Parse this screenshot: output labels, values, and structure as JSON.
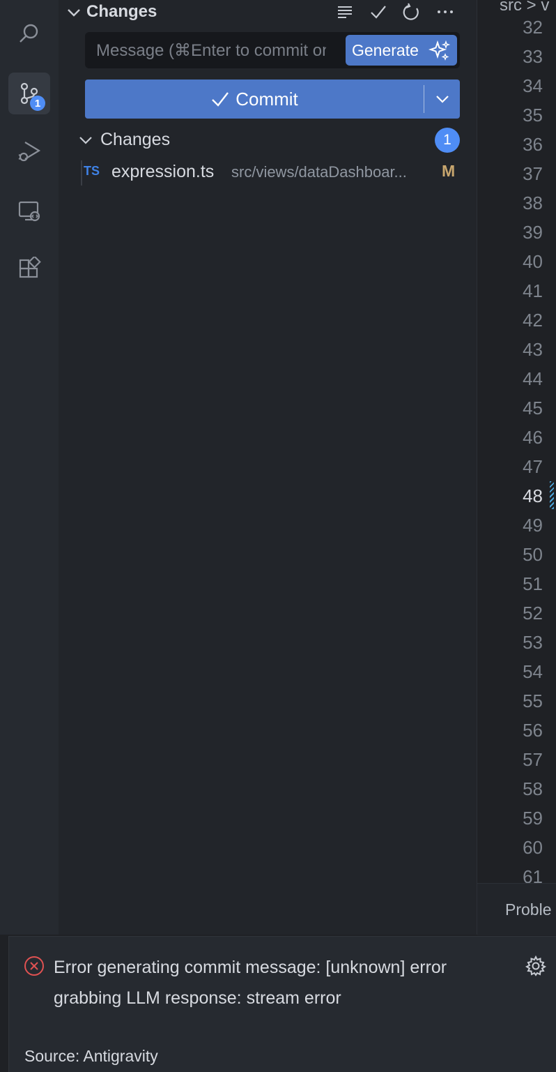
{
  "activity_bar": {
    "items": [
      {
        "name": "search",
        "icon": "search-icon"
      },
      {
        "name": "source-control",
        "icon": "source-control-icon",
        "badge": "1",
        "active": true
      },
      {
        "name": "run-debug",
        "icon": "run-debug-icon"
      },
      {
        "name": "remote-explorer",
        "icon": "remote-explorer-icon"
      },
      {
        "name": "extensions",
        "icon": "extensions-icon"
      }
    ]
  },
  "scm": {
    "header_title": "Changes",
    "toolbar_icons": [
      "view-as-list-icon",
      "check-icon",
      "refresh-icon",
      "more-icon"
    ],
    "message_placeholder": "Message (⌘Enter to commit on 'main')",
    "generate_label": "Generate",
    "commit_label": "Commit",
    "changes_group_label": "Changes",
    "changes_count": "1",
    "files": [
      {
        "icon_text": "TS",
        "name": "expression.ts",
        "path": "src/views/dataDashboar...",
        "status": "M"
      }
    ]
  },
  "editor": {
    "breadcrumb": "src > v",
    "line_numbers": [
      "32",
      "33",
      "34",
      "35",
      "36",
      "37",
      "38",
      "39",
      "40",
      "41",
      "42",
      "43",
      "44",
      "45",
      "46",
      "47",
      "48",
      "49",
      "50",
      "51",
      "52",
      "53",
      "54",
      "55",
      "56",
      "57",
      "58",
      "59",
      "60",
      "61"
    ],
    "current_line": "48",
    "bottom_tab": "Proble"
  },
  "notification": {
    "message": "Error generating commit message: [unknown] error grabbing LLM response: stream error",
    "source": "Source: Antigravity"
  },
  "colors": {
    "accent": "#4d78c8",
    "badge": "#4f8df5",
    "modified": "#c8a66e",
    "error": "#e05252"
  }
}
